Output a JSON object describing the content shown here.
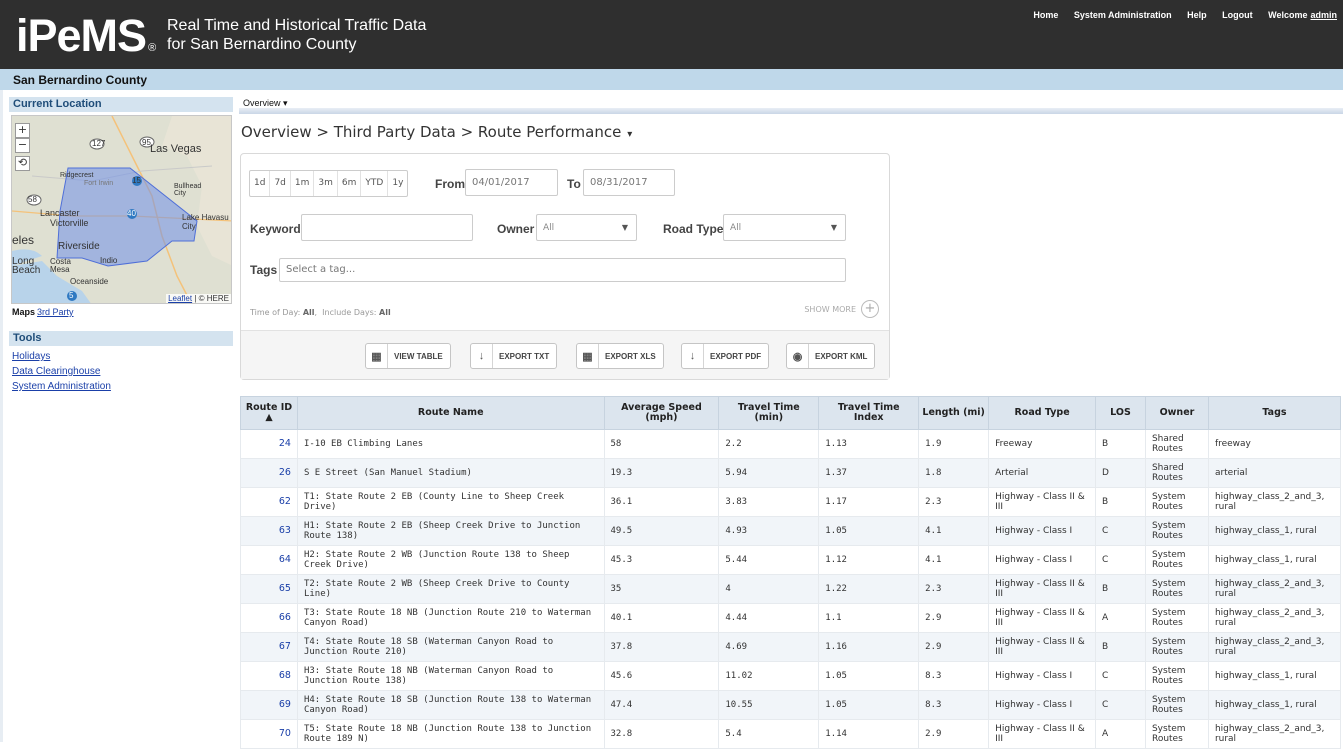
{
  "header": {
    "logo": "PeMS",
    "logo_prefix": "i",
    "logo_reg": "®",
    "tagline_line1": "Real Time and Historical Traffic Data",
    "tagline_line2": "for San Bernardino County",
    "nav": {
      "home": "Home",
      "sysadmin": "System Administration",
      "help": "Help",
      "logout": "Logout",
      "welcome": "Welcome",
      "user": "admin"
    }
  },
  "county": "San Bernardino County",
  "sidebar": {
    "current_location": "Current Location",
    "map": {
      "zoom_in": "+",
      "zoom_out": "−",
      "reset": "⟲",
      "labels": {
        "las_vegas": "Las Vegas",
        "ridgecrest": "Ridgecrest",
        "fort_irwin": "Fort Irwin",
        "bullhead": "Bullhead City",
        "lancaster": "Lancaster",
        "victorville": "Victorville",
        "lake_havasu": "Lake Havasu City",
        "eles": "eles",
        "riverside": "Riverside",
        "costa_mesa": "Costa Mesa",
        "indio": "Indio",
        "long_beach": "Long Beach",
        "oceanside": "Oceanside",
        "r127": "127",
        "r95": "95",
        "r58": "58",
        "r15": "15",
        "r40": "40",
        "r5": "5"
      },
      "attribution_link": "Leaflet",
      "attribution_rest": "| © HERE"
    },
    "maps_label": "Maps",
    "maps_link": "3rd Party",
    "tools_title": "Tools",
    "tools": [
      "Holidays",
      "Data Clearinghouse",
      "System Administration"
    ]
  },
  "main": {
    "tab": "Overview ▾",
    "breadcrumb": "Overview > Third Party Data > Route Performance",
    "breadcrumb_caret": "▾",
    "filters": {
      "ranges": [
        "1d",
        "7d",
        "1m",
        "3m",
        "6m",
        "YTD",
        "1y"
      ],
      "from_label": "From",
      "from_value": "04/01/2017",
      "to_label": "To",
      "to_value": "08/31/2017",
      "keyword_label": "Keyword",
      "keyword_value": "",
      "owner_label": "Owner",
      "owner_value": "All",
      "roadtype_label": "Road Type",
      "roadtype_value": "All",
      "tags_label": "Tags",
      "tags_placeholder": "Select a tag...",
      "time_of_day_label": "Time of Day:",
      "time_of_day_value": "All",
      "include_days_label": "Include Days:",
      "include_days_value": "All",
      "show_more": "SHOW MORE"
    },
    "exports": {
      "view_table": "VIEW TABLE",
      "export_txt": "EXPORT TXT",
      "export_xls": "EXPORT XLS",
      "export_pdf": "EXPORT PDF",
      "export_kml": "EXPORT KML"
    }
  },
  "table": {
    "headers": {
      "route_id": "Route ID",
      "route_name": "Route Name",
      "avg_speed": "Average Speed (mph)",
      "travel_time": "Travel Time (min)",
      "tti": "Travel Time Index",
      "length": "Length (mi)",
      "road_type": "Road Type",
      "los": "LOS",
      "owner": "Owner",
      "tags": "Tags"
    },
    "rows": [
      {
        "id": "24",
        "name": "I-10 EB Climbing Lanes",
        "speed": "58",
        "tt": "2.2",
        "tti": "1.13",
        "len": "1.9",
        "type": "Freeway",
        "los": "B",
        "owner": "Shared Routes",
        "tags": "freeway"
      },
      {
        "id": "26",
        "name": "S E Street (San Manuel Stadium)",
        "speed": "19.3",
        "tt": "5.94",
        "tti": "1.37",
        "len": "1.8",
        "type": "Arterial",
        "los": "D",
        "owner": "Shared Routes",
        "tags": "arterial"
      },
      {
        "id": "62",
        "name": "T1: State Route 2 EB (County Line to Sheep Creek Drive)",
        "speed": "36.1",
        "tt": "3.83",
        "tti": "1.17",
        "len": "2.3",
        "type": "Highway - Class II & III",
        "los": "B",
        "owner": "System Routes",
        "tags": "highway_class_2_and_3, rural"
      },
      {
        "id": "63",
        "name": "H1: State Route 2 EB (Sheep Creek Drive to Junction Route 138)",
        "speed": "49.5",
        "tt": "4.93",
        "tti": "1.05",
        "len": "4.1",
        "type": "Highway - Class I",
        "los": "C",
        "owner": "System Routes",
        "tags": "highway_class_1, rural"
      },
      {
        "id": "64",
        "name": "H2: State Route 2 WB (Junction Route 138 to Sheep Creek Drive)",
        "speed": "45.3",
        "tt": "5.44",
        "tti": "1.12",
        "len": "4.1",
        "type": "Highway - Class I",
        "los": "C",
        "owner": "System Routes",
        "tags": "highway_class_1, rural"
      },
      {
        "id": "65",
        "name": "T2: State Route 2 WB (Sheep Creek Drive to County Line)",
        "speed": "35",
        "tt": "4",
        "tti": "1.22",
        "len": "2.3",
        "type": "Highway - Class II & III",
        "los": "B",
        "owner": "System Routes",
        "tags": "highway_class_2_and_3, rural"
      },
      {
        "id": "66",
        "name": "T3: State Route 18 NB (Junction Route 210 to Waterman Canyon Road)",
        "speed": "40.1",
        "tt": "4.44",
        "tti": "1.1",
        "len": "2.9",
        "type": "Highway - Class II & III",
        "los": "A",
        "owner": "System Routes",
        "tags": "highway_class_2_and_3, rural"
      },
      {
        "id": "67",
        "name": "T4: State Route 18 SB (Waterman Canyon Road to Junction Route 210)",
        "speed": "37.8",
        "tt": "4.69",
        "tti": "1.16",
        "len": "2.9",
        "type": "Highway - Class II & III",
        "los": "B",
        "owner": "System Routes",
        "tags": "highway_class_2_and_3, rural"
      },
      {
        "id": "68",
        "name": "H3: State Route 18 NB (Waterman Canyon Road to Junction Route 138)",
        "speed": "45.6",
        "tt": "11.02",
        "tti": "1.05",
        "len": "8.3",
        "type": "Highway - Class I",
        "los": "C",
        "owner": "System Routes",
        "tags": "highway_class_1, rural"
      },
      {
        "id": "69",
        "name": "H4: State Route 18 SB (Junction Route 138 to Waterman Canyon Road)",
        "speed": "47.4",
        "tt": "10.55",
        "tti": "1.05",
        "len": "8.3",
        "type": "Highway - Class I",
        "los": "C",
        "owner": "System Routes",
        "tags": "highway_class_1, rural"
      },
      {
        "id": "70",
        "name": "T5: State Route 18 NB (Junction Route 138 to Junction Route 189 N)",
        "speed": "32.8",
        "tt": "5.4",
        "tti": "1.14",
        "len": "2.9",
        "type": "Highway - Class II & III",
        "los": "A",
        "owner": "System Routes",
        "tags": "highway_class_2_and_3, rural"
      }
    ]
  },
  "colors": {
    "header_bg": "#2f2f2f",
    "county_bar": "#bfd8ea",
    "link": "#1a3fa8",
    "table_head": "#dce5ee",
    "map_polygon": "#6f8fe8"
  }
}
